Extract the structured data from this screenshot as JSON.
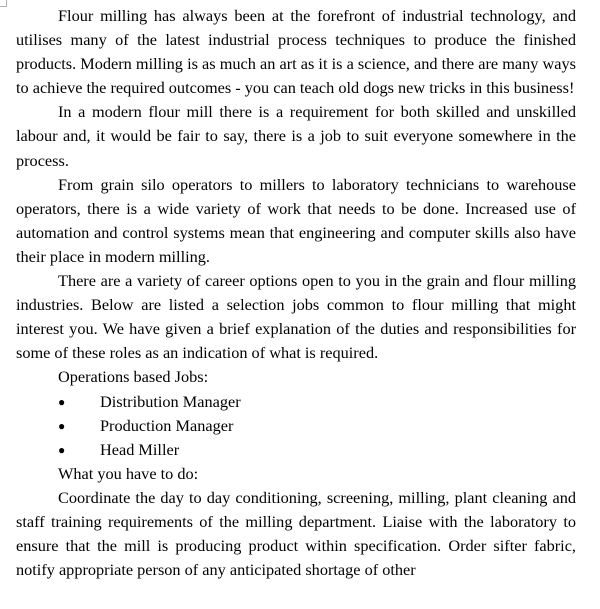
{
  "document": {
    "paragraphs": [
      "Flour milling has always been at the forefront of industrial technology, and utilises many of the latest industrial process techniques to produce the finished products. Modern milling is as much an art as it is a science, and there are many ways to achieve the required outcomes - you can teach old dogs new tricks in this business!",
      "In a modern flour mill there is a requirement for both skilled and unskilled labour and, it would be fair to say, there is a job to suit everyone somewhere in the process.",
      "From grain silo operators to millers to laboratory technicians to warehouse operators, there is a wide variety of work that needs to be done. Increased use of automation and control systems mean that engineering and computer skills also have their place in modern milling.",
      "There are a variety of career options open to you in the grain and flour milling industries. Below are listed a selection jobs common to flour milling that might interest you. We have given a brief explanation of the duties and responsibilities for some of these roles as an indication of what is required."
    ],
    "jobs_heading": "Operations based Jobs:",
    "jobs": [
      "Distribution Manager",
      "Production Manager",
      "Head Miller"
    ],
    "duties_heading": "What you have to do:",
    "duties_paragraph": "Coordinate the day to day conditioning, screening, milling, plant cleaning and staff training requirements of the milling department. Liaise with the laboratory to ensure that the mill is producing product within specification. Order sifter fabric, notify appropriate person of any anticipated shortage of other"
  }
}
